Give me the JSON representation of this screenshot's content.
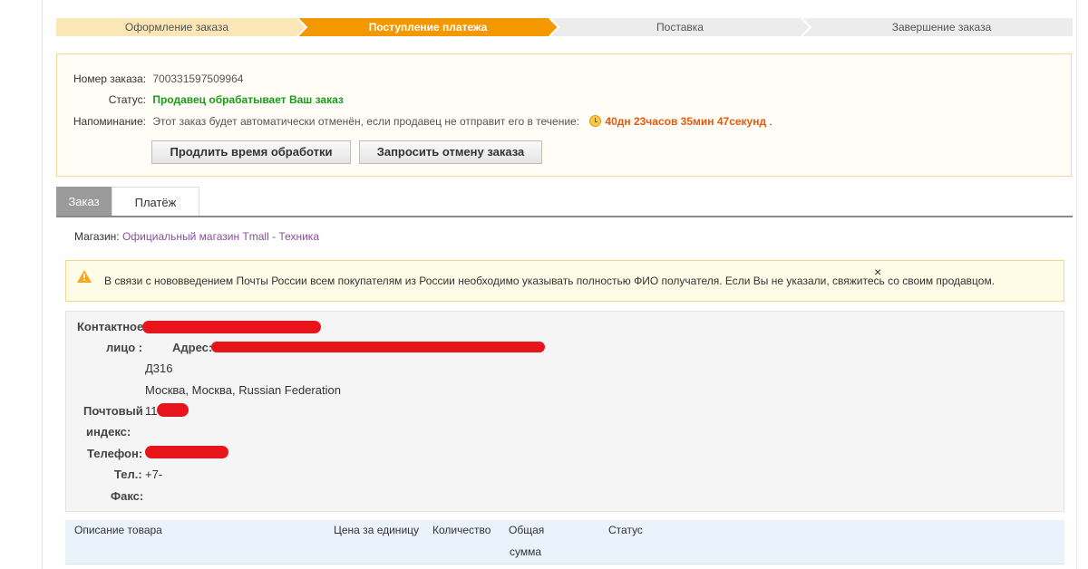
{
  "steps": [
    {
      "label": "Оформление заказа"
    },
    {
      "label": "Поступление платежа"
    },
    {
      "label": "Поставка"
    },
    {
      "label": "Завершение заказа"
    }
  ],
  "colors": {
    "step_done": "#fbe7b5",
    "step_active": "#f39800",
    "step_todo": "#ececec"
  },
  "order": {
    "number_label": "Номер заказа:",
    "number": "700331597509964",
    "status_label": "Статус:",
    "status": "Продавец обрабатывает Ваш заказ",
    "reminder_label": "Напоминание:",
    "reminder_text": "Этот заказ будет автоматически отменён, если продавец не отправит его в течение:",
    "countdown": "40дн 23часов 35мин 47секунд",
    "countdown_suffix": " .",
    "extend_button": "Продлить время обработки",
    "cancel_button": "Запросить отмену заказа"
  },
  "tabs": [
    {
      "label": "Заказ"
    },
    {
      "label": "Платёж"
    }
  ],
  "store": {
    "label": "Магазин:",
    "name": "Официальный магазин Tmall - Техника"
  },
  "notice": {
    "icon": "warning-icon",
    "text": "В связи с нововведением Почты России всем покупателям из России необходимо указывать полностью ФИО получателя. Если Вы не указали, свяжитесь со своим продавцом.",
    "close": "×"
  },
  "contact": {
    "contact_label_1": "Контактное",
    "contact_label_2": "лицо :",
    "address_label": "Адрес:",
    "address_line2": "Д316",
    "address_line3": "Москва, Москва, Russian Federation",
    "postal_label_1": "Почтовый",
    "postal_label_2": "индекс:",
    "postal_value": "11",
    "phone_label": "Телефон:",
    "tel_label": "Тел.:",
    "tel_value": "+7-",
    "fax_label": "Факс:"
  },
  "table": {
    "headers": [
      "Описание товара",
      "Цена за единицу",
      "Количество",
      "Общая",
      "сумма",
      "Статус"
    ]
  }
}
